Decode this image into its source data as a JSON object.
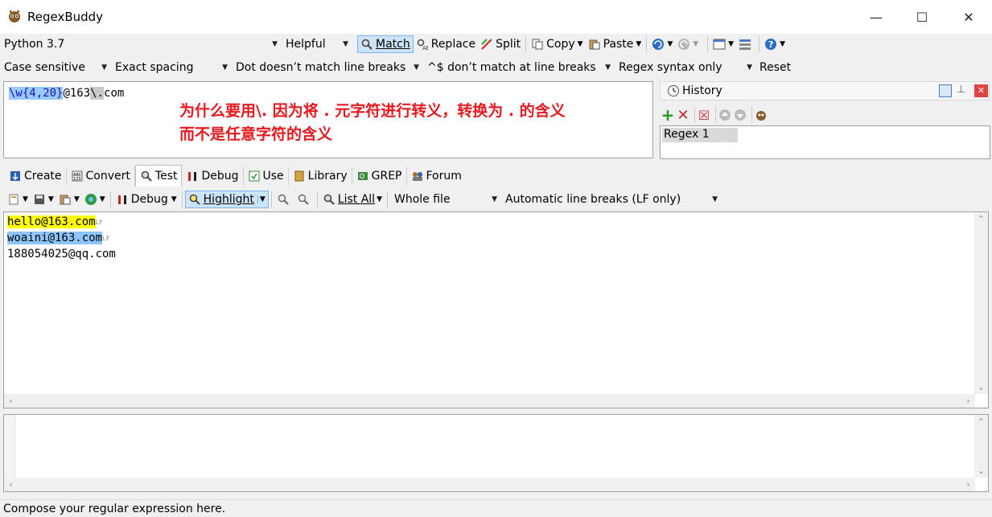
{
  "window": {
    "title": "RegexBuddy",
    "minimize": "—",
    "maximize": "☐",
    "close": "✕"
  },
  "toolbar1": {
    "flavor": "Python 3.7",
    "helpful": "Helpful",
    "match": "Match",
    "replace": "Replace",
    "split": "Split",
    "copy": "Copy",
    "paste": "Paste"
  },
  "toolbar2": {
    "case": "Case sensitive",
    "spacing": "Exact spacing",
    "dot": "Dot doesn’t match line breaks",
    "anchors": "^$ don’t match at line breaks",
    "syntax": "Regex syntax only",
    "reset": "Reset"
  },
  "regex": {
    "part1": "\\w{4,20}",
    "part2": "@163",
    "part3": "\\.",
    "part4": "com",
    "annotation_line1": "为什么要用\\.  因为将 . 元字符进行转义，转换为 . 的含义",
    "annotation_line2": "而不是任意字符的含义"
  },
  "history": {
    "title": "History",
    "item": "Regex 1"
  },
  "tabs": [
    "Create",
    "Convert",
    "Test",
    "Debug",
    "Use",
    "Library",
    "GREP",
    "Forum"
  ],
  "testbar": {
    "debug": "Debug",
    "highlight": "Highlight",
    "list_all": "List All",
    "scope": "Whole file",
    "linebreaks": "Automatic line breaks (LF only)"
  },
  "test_lines": [
    "hello@163.com",
    "woaini@163.com",
    "188054025@qq.com"
  ],
  "status": "Compose your regular expression here.",
  "colors": {
    "annotation": "#e8191e",
    "match1": "#ffff00",
    "match2": "#8ec5ff",
    "selection": "#99c9ff"
  }
}
